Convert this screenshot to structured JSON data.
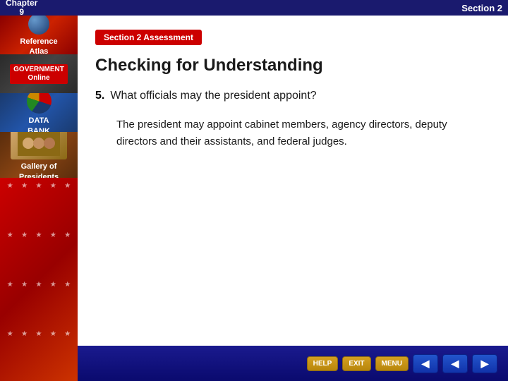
{
  "header": {
    "chapter_label": "Chapter",
    "chapter_number": "9",
    "section_label": "Section 2"
  },
  "sidebar": {
    "items": [
      {
        "id": "reference-atlas",
        "line1": "Reference",
        "line2": "Atlas"
      },
      {
        "id": "government-online",
        "line1": "GOVERNMENT",
        "line2": "Online"
      },
      {
        "id": "data-bank",
        "line1": "DATA",
        "line2": "BANK"
      },
      {
        "id": "gallery-presidents",
        "line1": "Gallery of",
        "line2": "Presidents"
      }
    ]
  },
  "main": {
    "section_badge": "Section 2 Assessment",
    "page_title": "Checking for Understanding",
    "question": {
      "number": "5.",
      "text": "What officials may the president appoint?",
      "answer": "The president may appoint cabinet members, agency directors, deputy directors and their assistants, and federal judges."
    }
  },
  "toolbar": {
    "help_label": "HELP",
    "exit_label": "EXIT",
    "menu_label": "MENU",
    "back_label": "◀",
    "prev_label": "◀",
    "next_label": "▶"
  }
}
